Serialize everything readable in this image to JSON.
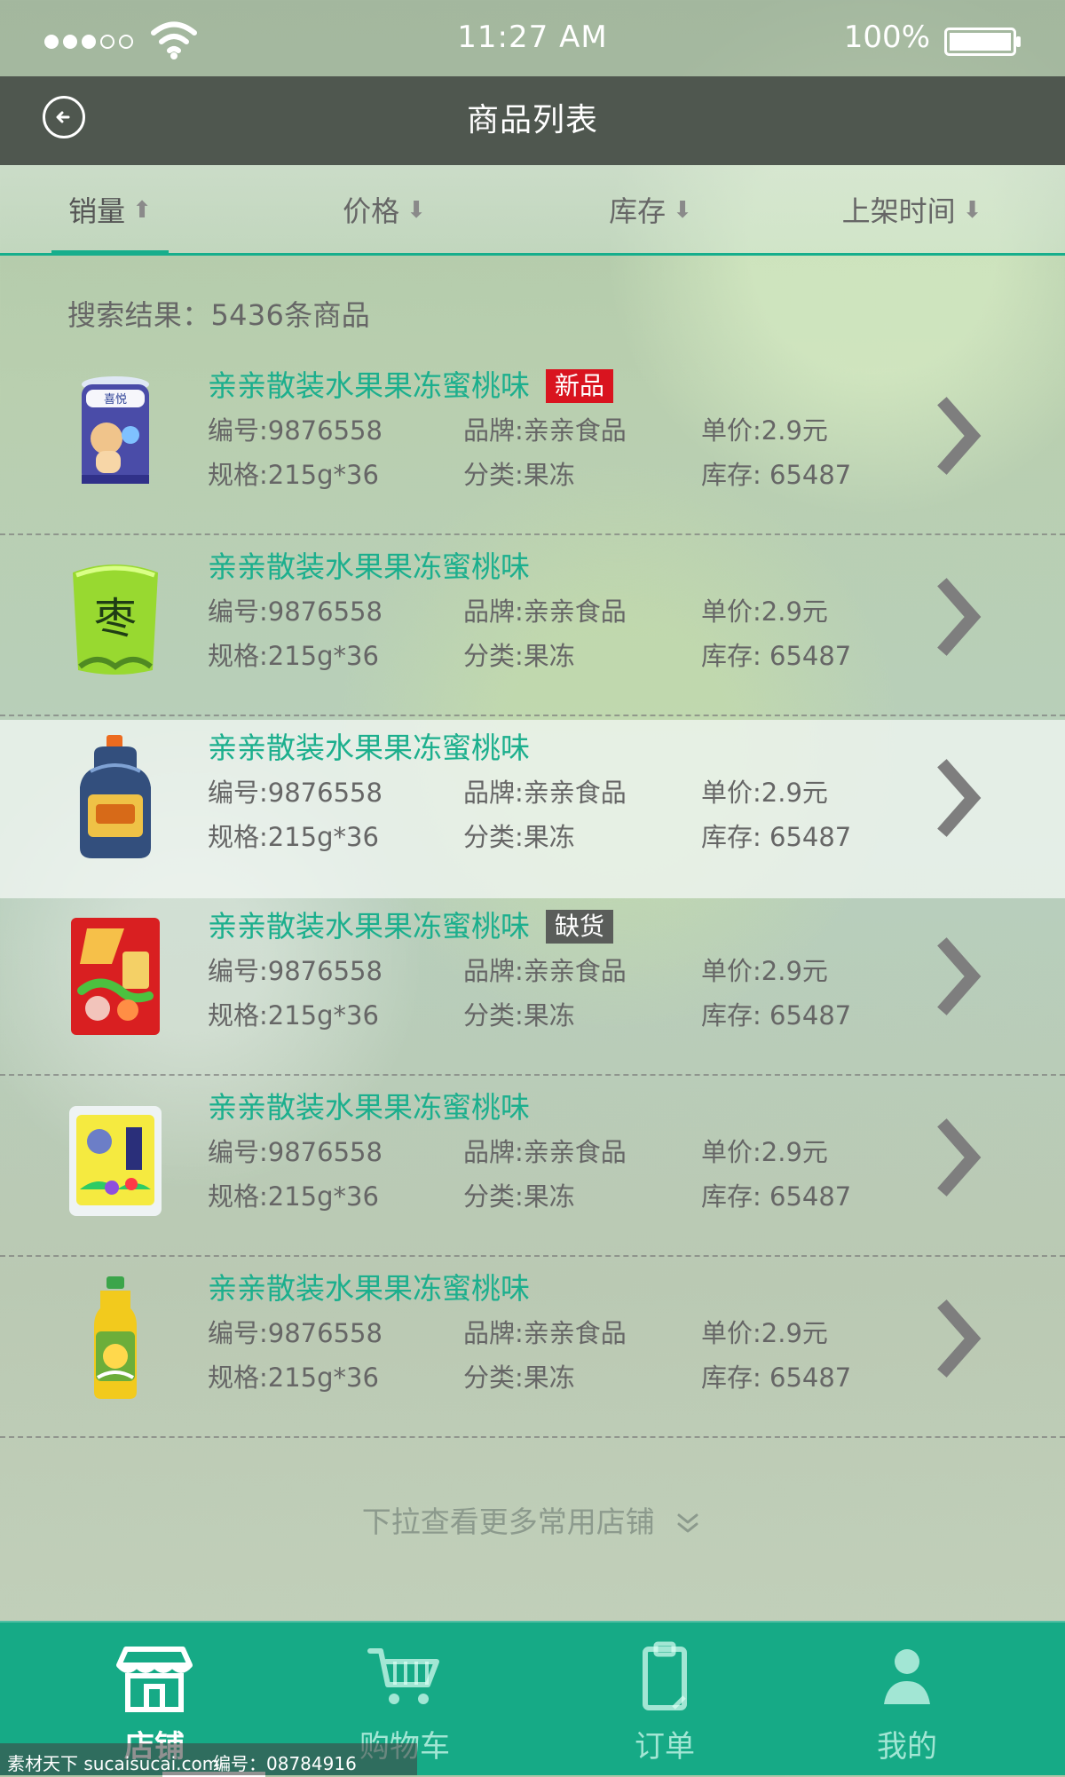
{
  "status_bar": {
    "time": "11:27 AM",
    "battery": "100%",
    "signal_icon": "signal-dots-icon",
    "wifi_icon": "wifi-icon",
    "battery_icon": "battery-icon"
  },
  "header": {
    "title": "商品列表",
    "back_icon": "back-arrow-icon"
  },
  "sort_tabs": [
    {
      "label": "销量",
      "arrow": "⬆",
      "active": true
    },
    {
      "label": "价格",
      "arrow": "⬇",
      "active": false
    },
    {
      "label": "库存",
      "arrow": "⬇",
      "active": false
    },
    {
      "label": "上架时间",
      "arrow": "⬇",
      "active": false
    }
  ],
  "search": {
    "summary": "搜索结果：5436条商品"
  },
  "products": [
    {
      "name": "亲亲散装水果果冻蜜桃味",
      "badge": "新品",
      "code": "编号:9876558",
      "brand": "品牌:亲亲食品",
      "price": "单价:2.9元",
      "spec": "规格:215g*36",
      "category": "分类:果冻",
      "stock": "库存: 65487",
      "thumbnail_icon": "jelly-can-icon"
    },
    {
      "name": "亲亲散装水果果冻蜜桃味",
      "badge": "",
      "code": "编号:9876558",
      "brand": "品牌:亲亲食品",
      "price": "单价:2.9元",
      "spec": "规格:215g*36",
      "category": "分类:果冻",
      "stock": "库存: 65487",
      "thumbnail_icon": "green-bag-icon"
    },
    {
      "name": "亲亲散装水果果冻蜜桃味",
      "badge": "",
      "code": "编号:9876558",
      "brand": "品牌:亲亲食品",
      "price": "单价:2.9元",
      "spec": "规格:215g*36",
      "category": "分类:果冻",
      "stock": "库存: 65487",
      "thumbnail_icon": "sauce-bottle-icon"
    },
    {
      "name": "亲亲散装水果果冻蜜桃味",
      "badge": "缺货",
      "code": "编号:9876558",
      "brand": "品牌:亲亲食品",
      "price": "单价:2.9元",
      "spec": "规格:215g*36",
      "category": "分类:果冻",
      "stock": "库存: 65487",
      "thumbnail_icon": "red-seasoning-pack-icon"
    },
    {
      "name": "亲亲散装水果果冻蜜桃味",
      "badge": "",
      "code": "编号:9876558",
      "brand": "品牌:亲亲食品",
      "price": "单价:2.9元",
      "spec": "规格:215g*36",
      "category": "分类:果冻",
      "stock": "库存: 65487",
      "thumbnail_icon": "spice-pack-icon"
    },
    {
      "name": "亲亲散装水果果冻蜜桃味",
      "badge": "",
      "code": "编号:9876558",
      "brand": "品牌:亲亲食品",
      "price": "单价:2.9元",
      "spec": "规格:215g*36",
      "category": "分类:果冻",
      "stock": "库存: 65487",
      "thumbnail_icon": "tea-bottle-icon"
    }
  ],
  "footer_hint": {
    "text": "下拉查看更多常用店铺",
    "icon": "double-chevron-down-icon"
  },
  "bottom_nav": [
    {
      "label": "店铺",
      "icon": "store-icon",
      "active": true
    },
    {
      "label": "购物车",
      "icon": "cart-icon",
      "active": false
    },
    {
      "label": "订单",
      "icon": "clipboard-icon",
      "active": false
    },
    {
      "label": "我的",
      "icon": "user-icon",
      "active": false
    }
  ],
  "watermark": {
    "text": "素材天下 sucaisucai.com",
    "id": "编号：08784916"
  },
  "colors": {
    "accent": "#16aa86",
    "header_bg": "#4f574f",
    "badge_new": "#d9141f",
    "badge_out": "#5a5d5a",
    "product_name": "#1caf8d"
  }
}
